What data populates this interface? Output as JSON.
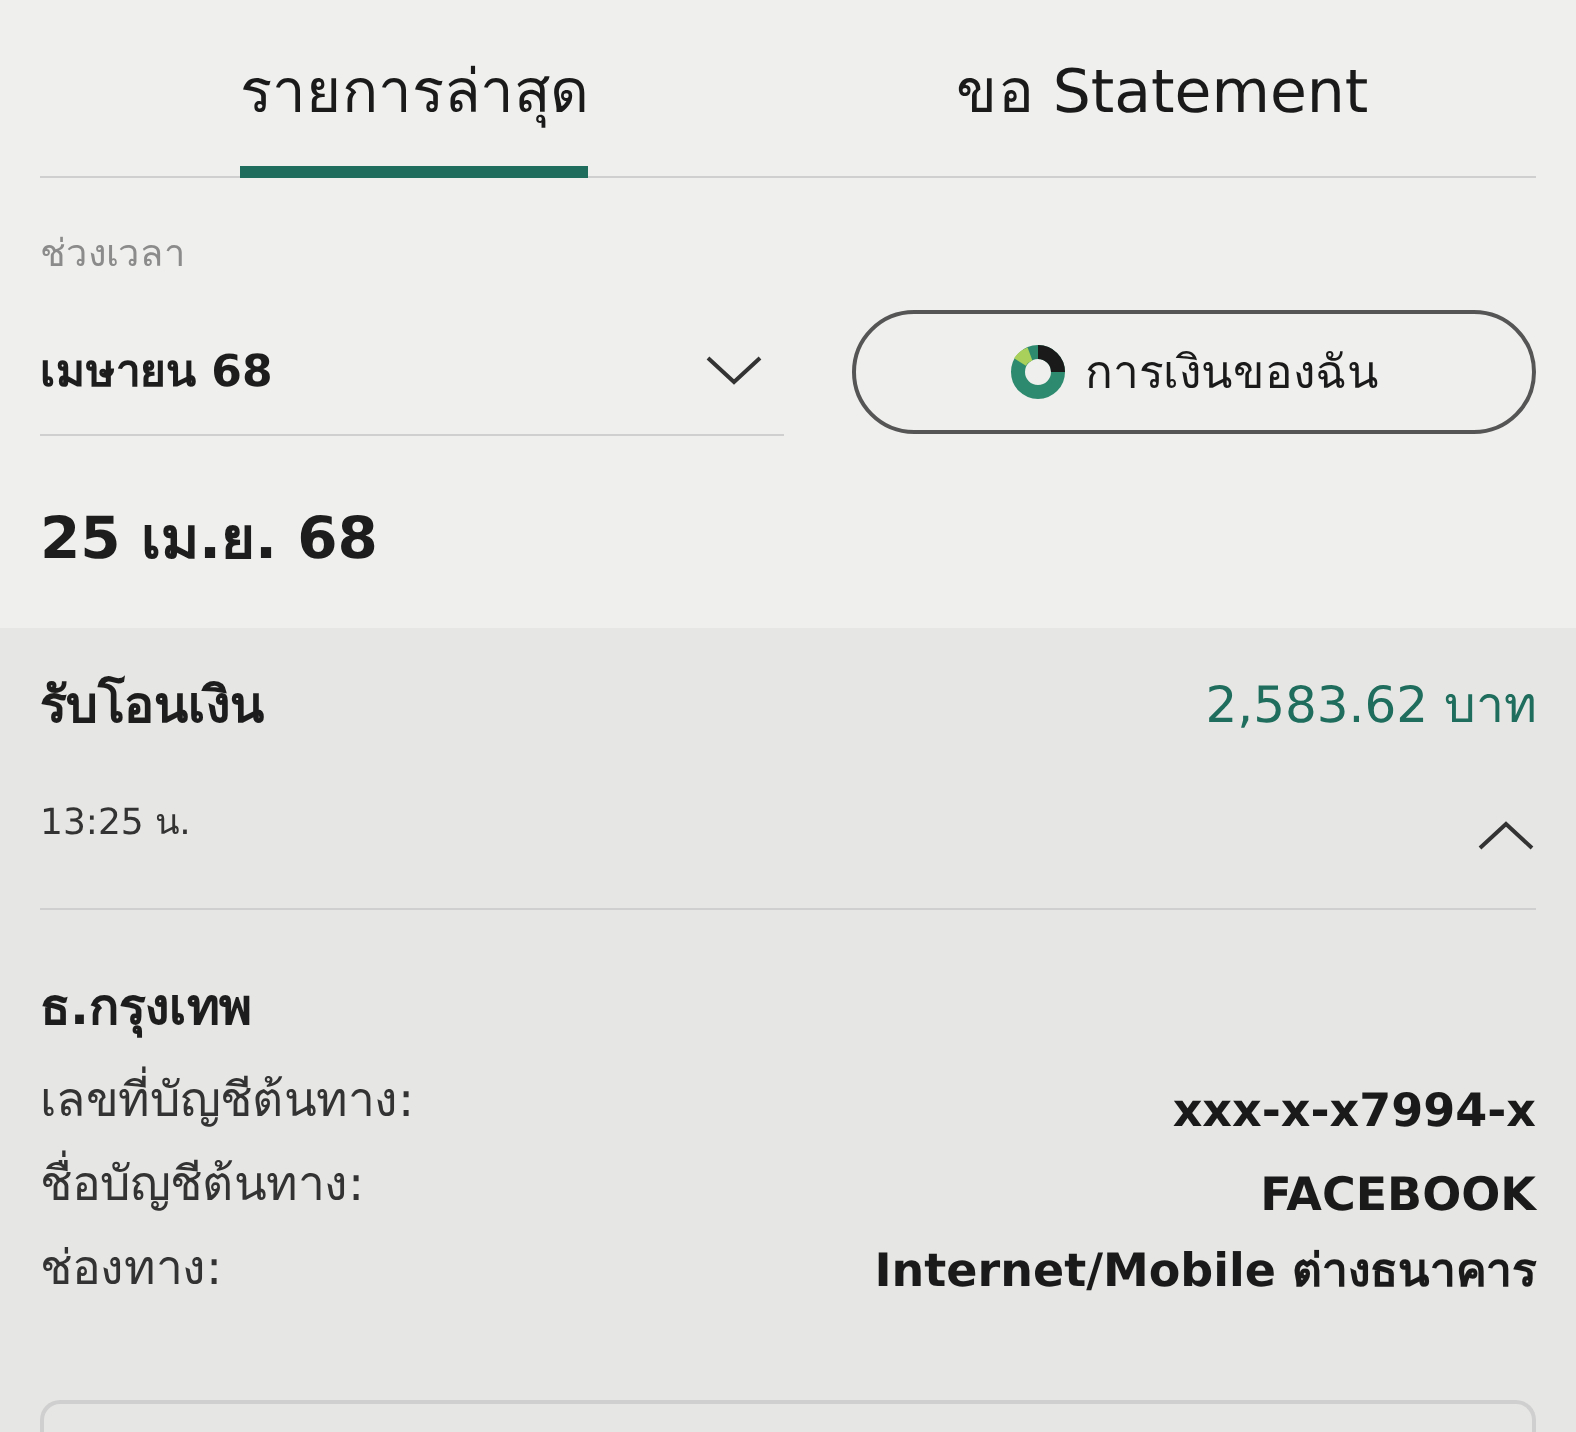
{
  "tabs": [
    {
      "label": "รายการล่าสุด",
      "selected": true
    },
    {
      "label": "ขอ Statement",
      "selected": false
    }
  ],
  "period": {
    "label": "ช่วงเวลา",
    "value": "เมษายน 68"
  },
  "my_finance_button": {
    "label": "การเงินของฉัน"
  },
  "date_heading": "25 เม.ย. 68",
  "transaction": {
    "title": "รับโอนเงิน",
    "amount": "2,583.62 บาท",
    "time": "13:25 น.",
    "expanded": true,
    "bank": "ธ.กรุงเทพ",
    "details": [
      {
        "label": "เลขที่บัญชีต้นทาง:",
        "value": "xxx-x-x7994-x"
      },
      {
        "label": "ชื่อบัญชีต้นทาง:",
        "value": "FACEBOOK"
      },
      {
        "label": "ช่องทาง:",
        "value": "Internet/Mobile ต่างธนาคาร"
      }
    ]
  }
}
